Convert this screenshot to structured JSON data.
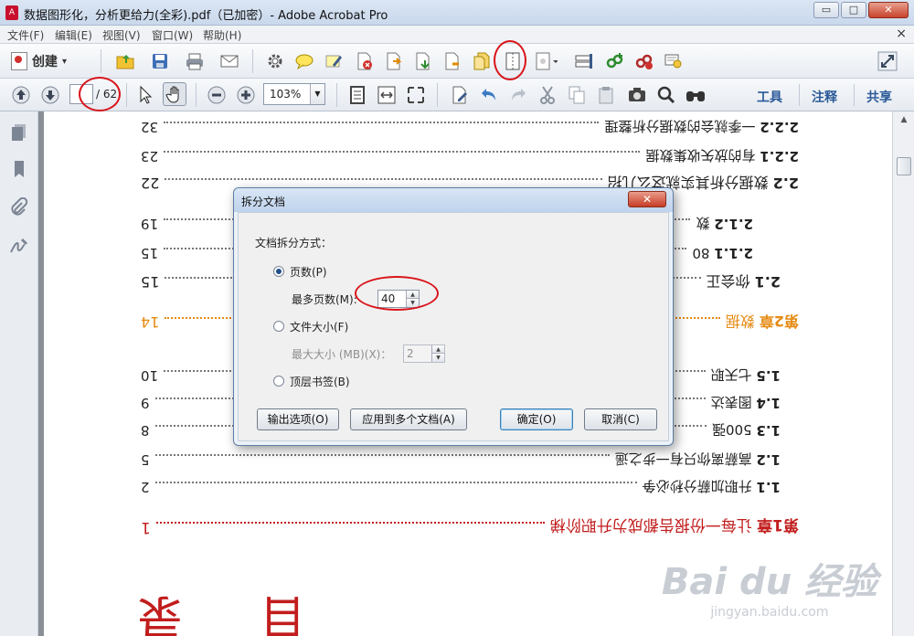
{
  "window": {
    "title": "数据图形化，分析更给力(全彩).pdf（已加密）- Adobe Acrobat Pro",
    "app_icon_label": "A",
    "minimize": "▭",
    "maximize": "□",
    "close": "✕"
  },
  "menu": [
    "文件(F)",
    "编辑(E)",
    "视图(V)",
    "窗口(W)",
    "帮助(H)"
  ],
  "menu_close": "×",
  "toolbar": {
    "create_label": "创建",
    "create_caret": "▾"
  },
  "nav": {
    "page_current": "",
    "page_total": "/ 62",
    "zoom": "103%",
    "zoom_dd": "▼"
  },
  "right_panes": [
    "工具",
    "注释",
    "共享"
  ],
  "toc": [
    {
      "num": "2.2.2",
      "text": "一季就会的数据分析整理",
      "page": "32"
    },
    {
      "num": "2.2.1",
      "text": "有的放矢收集数据",
      "page": "23"
    },
    {
      "num": "2.2",
      "text": "数据分析其实就这么几招",
      "page": "22"
    },
    {
      "num": "2.1.2",
      "text": "数",
      "page": "19"
    },
    {
      "num": "2.1.1",
      "text": "80",
      "page": "15"
    },
    {
      "num": "2.1",
      "text": "你会正",
      "page": "15"
    },
    {
      "num": "第2章",
      "text": "数据",
      "page": "14"
    },
    {
      "num": "1.5",
      "text": "七天职",
      "page": "10"
    },
    {
      "num": "1.4",
      "text": "图表达",
      "page": "9"
    },
    {
      "num": "1.3",
      "text": "500强",
      "page": "8"
    },
    {
      "num": "1.2",
      "text": "高薪离你只有一步之遥",
      "page": "5"
    },
    {
      "num": "1.1",
      "text": "升职加薪分秒必争",
      "page": "2"
    },
    {
      "num": "第1章",
      "text": "让每一份报告都成为升职阶梯",
      "page": "1"
    }
  ],
  "page_big_chars": [
    "目",
    "录"
  ],
  "dialog": {
    "title": "拆分文档",
    "close": "✕",
    "group_label": "文档拆分方式：",
    "opt_pages": "页数(P)",
    "max_pages_label": "最多页数(M):",
    "max_pages_value": "40",
    "opt_size": "文件大小(F)",
    "max_size_label": "最大大小 (MB)(X)：",
    "max_size_value": "2",
    "opt_bookmarks": "顶层书签(B)",
    "btn_output": "输出选项(O)",
    "btn_apply_multi": "应用到多个文档(A)",
    "btn_ok": "确定(O)",
    "btn_cancel": "取消(C)"
  },
  "watermark": {
    "logo": "Bai du 经验",
    "url": "jingyan.baidu.com"
  },
  "icons": {
    "up": "▲",
    "down": "▼",
    "spin_up": "▲",
    "spin_dn": "▼"
  }
}
